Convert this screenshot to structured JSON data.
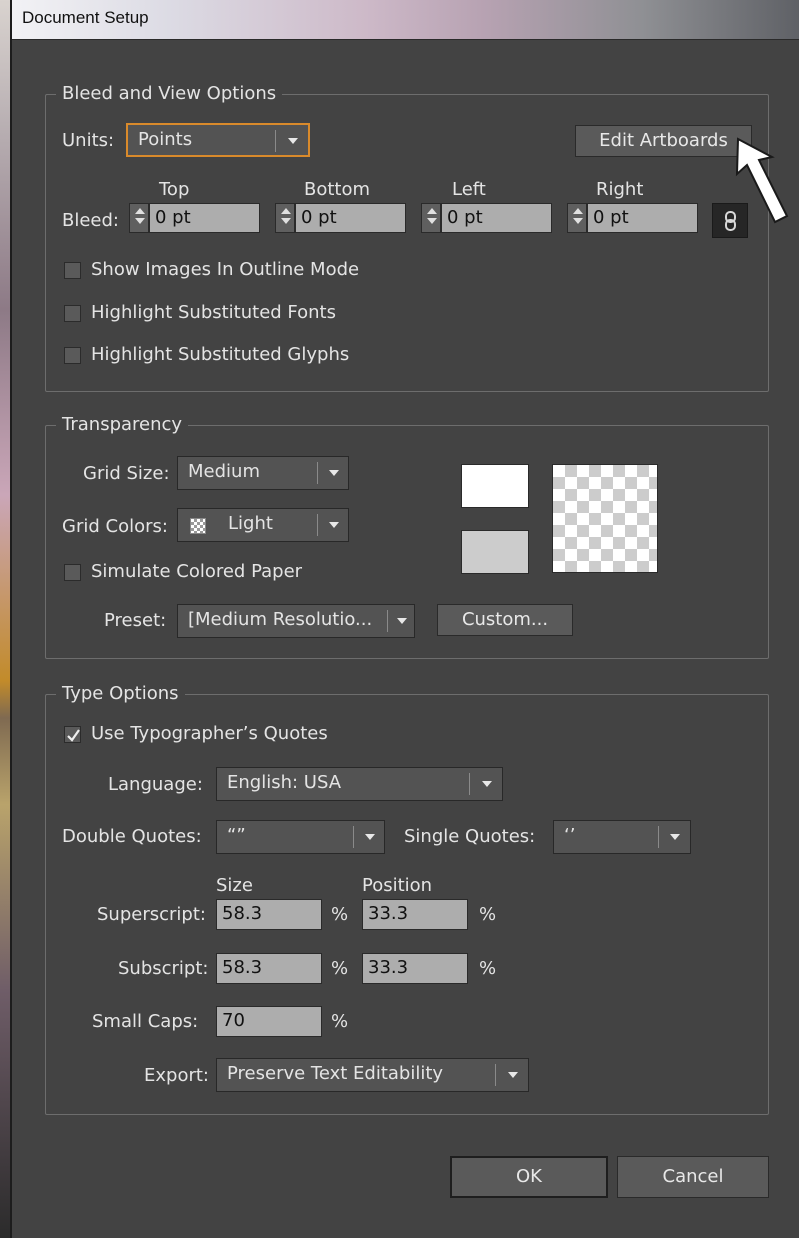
{
  "window": {
    "title": "Document Setup"
  },
  "bleed_view": {
    "legend": "Bleed and View Options",
    "units_label": "Units:",
    "units_value": "Points",
    "edit_artboards": "Edit Artboards",
    "bleed_label": "Bleed:",
    "columns": [
      "Top",
      "Bottom",
      "Left",
      "Right"
    ],
    "bleed_values": [
      "0 pt",
      "0 pt",
      "0 pt",
      "0 pt"
    ],
    "options": [
      "Show Images In Outline Mode",
      "Highlight Substituted Fonts",
      "Highlight Substituted Glyphs"
    ],
    "options_checked": [
      false,
      false,
      false
    ]
  },
  "transparency": {
    "legend": "Transparency",
    "grid_size_label": "Grid Size:",
    "grid_size_value": "Medium",
    "grid_colors_label": "Grid Colors:",
    "grid_colors_value": "Light",
    "simulate_paper": "Simulate Colored Paper",
    "simulate_paper_checked": false,
    "preset_label": "Preset:",
    "preset_value": "[Medium Resolutio...",
    "custom_button": "Custom...",
    "swatch_colors": [
      "#ffffff",
      "#cccccc"
    ]
  },
  "type_options": {
    "legend": "Type Options",
    "use_quotes": "Use Typographer’s Quotes",
    "use_quotes_checked": true,
    "language_label": "Language:",
    "language_value": "English: USA",
    "double_quotes_label": "Double Quotes:",
    "double_quotes_value": "“”",
    "single_quotes_label": "Single Quotes:",
    "single_quotes_value": "‘’",
    "size_header": "Size",
    "position_header": "Position",
    "superscript_label": "Superscript:",
    "superscript_size": "58.3",
    "superscript_position": "33.3",
    "subscript_label": "Subscript:",
    "subscript_size": "58.3",
    "subscript_position": "33.3",
    "small_caps_label": "Small Caps:",
    "small_caps_value": "70",
    "percent": "%",
    "export_label": "Export:",
    "export_value": "Preserve Text Editability"
  },
  "footer": {
    "ok": "OK",
    "cancel": "Cancel"
  }
}
